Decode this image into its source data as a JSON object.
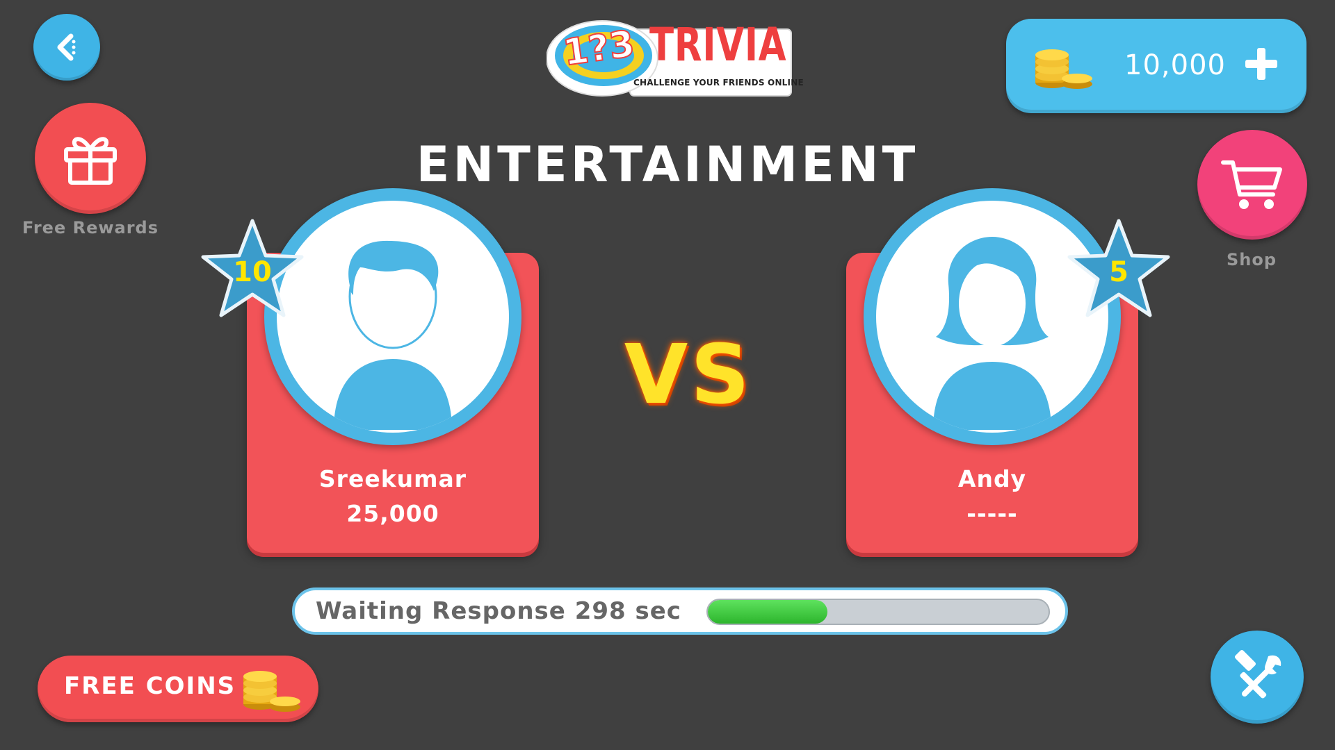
{
  "header": {
    "logo_number": "1?3",
    "logo_title": "TRIVIA",
    "logo_tagline": "CHALLENGE YOUR FRIENDS ONLINE",
    "back_icon": "chevron-left-icon"
  },
  "wallet": {
    "coins": "10,000",
    "add_icon": "plus-icon",
    "coin_icon": "coin-stack-icon"
  },
  "sidebar_left": {
    "free_rewards_label": "Free Rewards",
    "free_rewards_icon": "gift-icon"
  },
  "sidebar_right": {
    "shop_label": "Shop",
    "shop_icon": "cart-icon"
  },
  "match": {
    "category": "ENTERTAINMENT",
    "vs_label": "VS",
    "player1": {
      "name": "Sreekumar",
      "score": "25,000",
      "level": "10"
    },
    "player2": {
      "name": "Andy",
      "score": "-----",
      "level": "5"
    }
  },
  "waiting": {
    "text": "Waiting Response 298 sec",
    "progress": 0.35
  },
  "footer": {
    "free_coins_label": "FREE COINS",
    "settings_icon": "tools-icon"
  },
  "colors": {
    "background": "#404040",
    "accent_blue": "#3fb4e6",
    "card_red": "#f25358",
    "shop_pink": "#f2427a",
    "vs_yellow": "#ffe32a",
    "progress_green": "#3cc83c"
  }
}
